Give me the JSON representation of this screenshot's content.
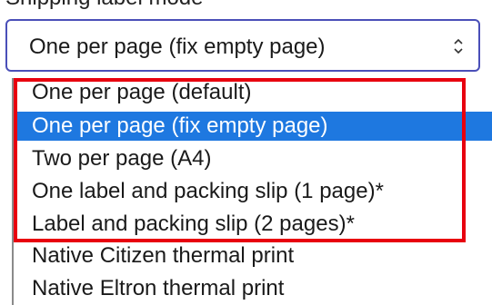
{
  "field": {
    "label": "Shipping label mode",
    "selected_value": "One per page (fix empty page)"
  },
  "dropdown": {
    "options": [
      {
        "label": "One per page (default)",
        "selected": false
      },
      {
        "label": "One per page (fix empty page)",
        "selected": true
      },
      {
        "label": "Two per page (A4)",
        "selected": false
      },
      {
        "label": "One label and packing slip (1 page)*",
        "selected": false
      },
      {
        "label": "Label and packing slip (2 pages)*",
        "selected": false
      },
      {
        "label": "Native Citizen thermal print",
        "selected": false
      },
      {
        "label": "Native Eltron thermal print",
        "selected": false
      }
    ]
  },
  "colors": {
    "selected_background": "#1e78e0",
    "select_border": "#4a4fb8",
    "annotation_highlight": "#e8000f"
  },
  "icons": {
    "select_arrows": "updown-chevron-icon"
  }
}
